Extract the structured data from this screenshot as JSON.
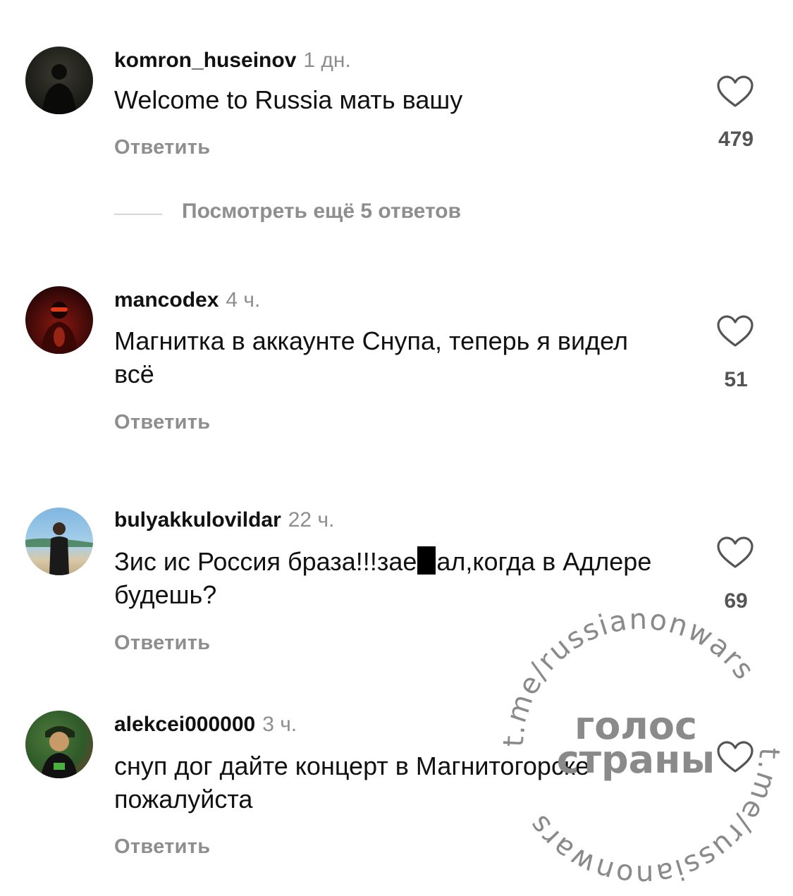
{
  "comments": [
    {
      "username": "komron_huseinov",
      "time": "1 дн.",
      "text": "Welcome to Russia мать вашу",
      "reply_label": "Ответить",
      "likes": "479",
      "avatar_colors": [
        "#1a1a16",
        "#3a3a30"
      ]
    },
    {
      "username": "mancodex",
      "time": "4 ч.",
      "text": "Магнитка в аккаунте Снупа, теперь я видел всё",
      "reply_label": "Ответить",
      "likes": "51",
      "avatar_colors": [
        "#2a0606",
        "#b02010"
      ]
    },
    {
      "username": "bulyakkulovildar",
      "time": "22 ч.",
      "text_before": "Зис ис Россия браза!!!зае",
      "text_after": "ал,когда в Адлере будешь?",
      "reply_label": "Ответить",
      "likes": "69",
      "avatar_colors": [
        "#6fa8d8",
        "#c8b89a"
      ]
    },
    {
      "username": "alekcei000000",
      "time": "3 ч.",
      "text": "снуп дог дайте концерт в Магнитогорске пожалуйста",
      "reply_label": "Ответить",
      "likes": "",
      "avatar_colors": [
        "#2f5a2a",
        "#8a6b3a"
      ]
    }
  ],
  "view_more": "Посмотреть ещё 5 ответов",
  "watermark": {
    "center_text_line1": "голос",
    "center_text_line2": "страны",
    "ring_text": "t.me/russianonwars",
    "color": "#8a8a8a"
  }
}
